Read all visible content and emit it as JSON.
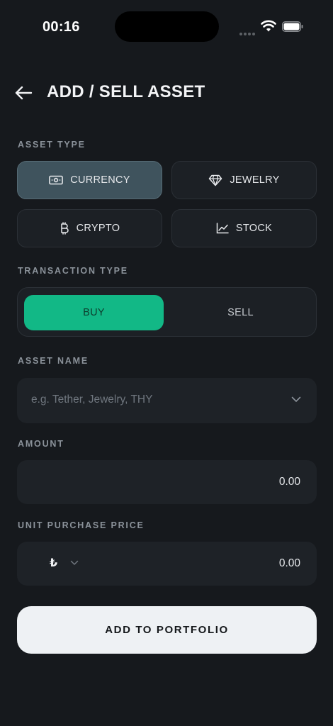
{
  "status": {
    "time": "00:16"
  },
  "header": {
    "title": "ADD / SELL ASSET"
  },
  "asset_type": {
    "label": "ASSET TYPE",
    "selected": "CURRENCY",
    "options": [
      {
        "label": "CURRENCY",
        "icon": "banknote-icon"
      },
      {
        "label": "JEWELRY",
        "icon": "diamond-icon"
      },
      {
        "label": "CRYPTO",
        "icon": "bitcoin-icon"
      },
      {
        "label": "STOCK",
        "icon": "chart-line-icon"
      }
    ]
  },
  "transaction_type": {
    "label": "TRANSACTION TYPE",
    "selected": "BUY",
    "buy_label": "BUY",
    "sell_label": "SELL"
  },
  "asset_name": {
    "label": "ASSET NAME",
    "placeholder": "e.g. Tether, Jewelry, THY"
  },
  "amount": {
    "label": "AMOUNT",
    "value": "0.00"
  },
  "unit_price": {
    "label": "UNIT PURCHASE PRICE",
    "currency_symbol": "₺",
    "value": "0.00"
  },
  "submit": {
    "label": "ADD TO PORTFOLIO"
  },
  "colors": {
    "background": "#16191d",
    "accent_buy": "#12b886",
    "selected_asset": "#3f535d",
    "submit_bg": "#eef1f4"
  }
}
